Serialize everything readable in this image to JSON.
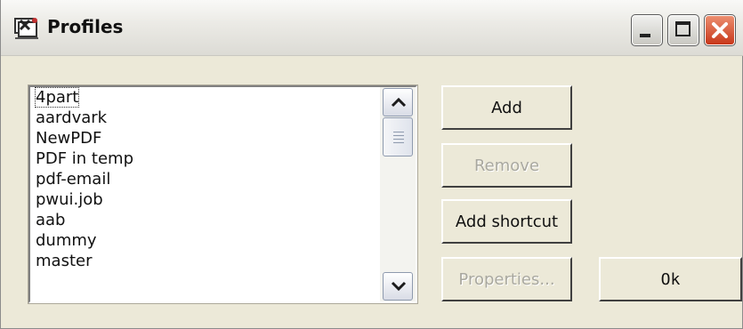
{
  "window": {
    "title": "Profiles",
    "controls": [
      "minimize-icon",
      "maximize-icon",
      "close-icon"
    ],
    "close_color": "#d9472b"
  },
  "list": {
    "selected_index": 0,
    "items": [
      "4part",
      "aardvark",
      "NewPDF",
      "PDF in temp",
      "pdf-email",
      "pwui.job",
      "aab",
      "dummy",
      "master"
    ]
  },
  "buttons": {
    "add": "Add",
    "remove": "Remove",
    "add_shortcut": "Add shortcut",
    "properties": "Properties...",
    "ok": "Ok"
  },
  "states": {
    "remove_enabled": false,
    "properties_enabled": false
  }
}
